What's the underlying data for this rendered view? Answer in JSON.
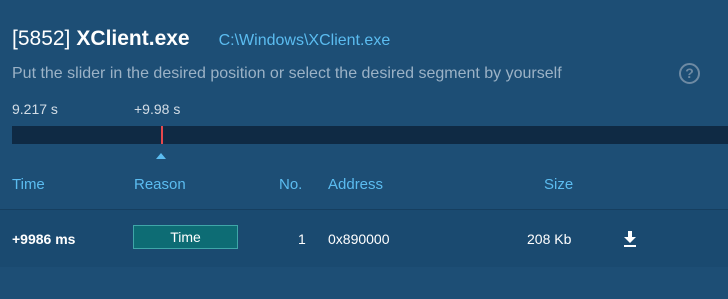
{
  "header": {
    "pid": "[5852]",
    "process_name": "XClient.exe",
    "path": "C:\\Windows\\XClient.exe"
  },
  "subtitle": "Put the slider in the desired position or select the desired segment by yourself",
  "help_icon_glyph": "?",
  "slider": {
    "start_time": "9.217 s",
    "offset_time": "+9.98 s",
    "marker_color": "#e5484d"
  },
  "table": {
    "columns": [
      "Time",
      "Reason",
      "No.",
      "Address",
      "Size"
    ],
    "rows": [
      {
        "time": "+9986 ms",
        "reason": "Time",
        "no": "1",
        "address": "0x890000",
        "size": "208 Kb",
        "action_icon": "download-icon"
      }
    ]
  },
  "colors": {
    "background": "#1d4e75",
    "accent": "#5bbcf0",
    "badge": "#0d6c74"
  }
}
